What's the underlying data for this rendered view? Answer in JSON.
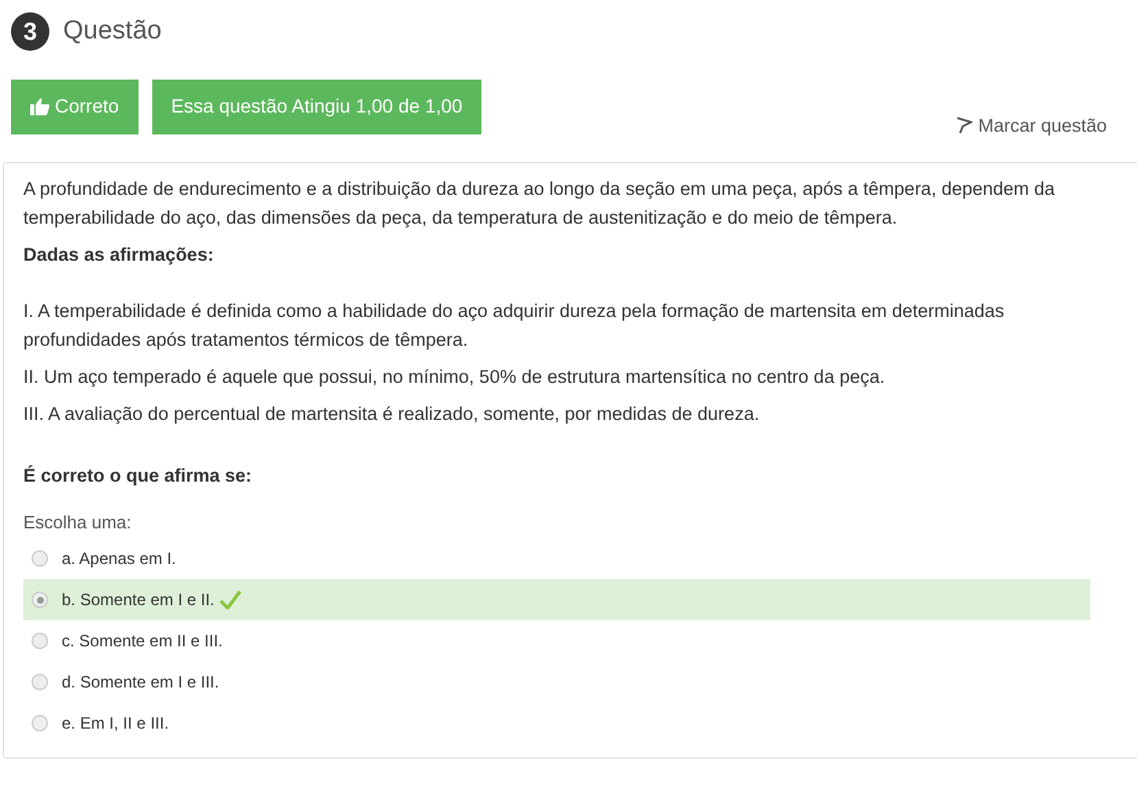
{
  "question": {
    "number": "3",
    "title": "Questão"
  },
  "status": {
    "result": "Correto",
    "grade": "Essa questão Atingiu 1,00 de 1,00",
    "flag": "Marcar questão"
  },
  "statement": {
    "paragraphs": [
      "A profundidade de endurecimento e a distribuição da dureza ao longo da seção em uma peça, após a têmpera, dependem da temperabilidade do aço, das dimensões da peça, da temperatura de austenitização e do meio de têmpera.",
      "Dadas as afirmações:"
    ],
    "affirmations": [
      "I. A temperabilidade é definida como a habilidade do aço adquirir dureza pela formação de martensita em determinadas profundidades após tratamentos térmicos de têmpera.",
      "II. Um aço temperado é aquele que possui, no mínimo, 50% de estrutura martensítica no centro da peça.",
      "III. A avaliação do percentual de martensita é realizado, somente, por medidas de dureza."
    ],
    "prompt": "É correto o que afirma se:"
  },
  "choices": {
    "label": "Escolha uma:",
    "options": [
      {
        "text": "a. Apenas em I.",
        "selected": false,
        "correct": false
      },
      {
        "text": "b. Somente em I e II.",
        "selected": true,
        "correct": true
      },
      {
        "text": "c. Somente em II e III.",
        "selected": false,
        "correct": false
      },
      {
        "text": "d. Somente em I e III.",
        "selected": false,
        "correct": false
      },
      {
        "text": "e. Em I, II e III.",
        "selected": false,
        "correct": false
      }
    ]
  }
}
